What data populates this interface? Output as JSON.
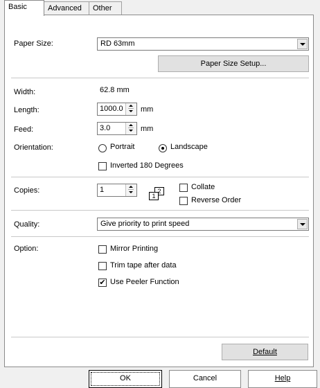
{
  "tabs": [
    {
      "label": "Basic",
      "active": true
    },
    {
      "label": "Advanced",
      "active": false
    },
    {
      "label": "Other",
      "active": false
    }
  ],
  "paper_size": {
    "label": "Paper Size:",
    "value": "RD 63mm",
    "setup_button": "Paper Size Setup..."
  },
  "width": {
    "label": "Width:",
    "value": "62.8 mm"
  },
  "length": {
    "label": "Length:",
    "value": "1000.0",
    "unit": "mm"
  },
  "feed": {
    "label": "Feed:",
    "value": "3.0",
    "unit": "mm"
  },
  "orientation": {
    "label": "Orientation:",
    "options": [
      {
        "label": "Portrait",
        "selected": false
      },
      {
        "label": "Landscape",
        "selected": true
      }
    ],
    "inverted_label": "Inverted 180 Degrees",
    "inverted_checked": false
  },
  "copies": {
    "label": "Copies:",
    "value": "1",
    "collate_label": "Collate",
    "collate_checked": false,
    "reverse_label": "Reverse Order",
    "reverse_checked": false,
    "icon_pages": [
      "1",
      "2"
    ]
  },
  "quality": {
    "label": "Quality:",
    "value": "Give priority to print speed"
  },
  "option": {
    "label": "Option:",
    "items": [
      {
        "label": "Mirror Printing",
        "checked": false
      },
      {
        "label": "Trim tape after data",
        "checked": false
      },
      {
        "label": "Use Peeler Function",
        "checked": true
      }
    ]
  },
  "default_button": "Default",
  "footer": {
    "ok": "OK",
    "cancel": "Cancel",
    "help": "Help"
  }
}
